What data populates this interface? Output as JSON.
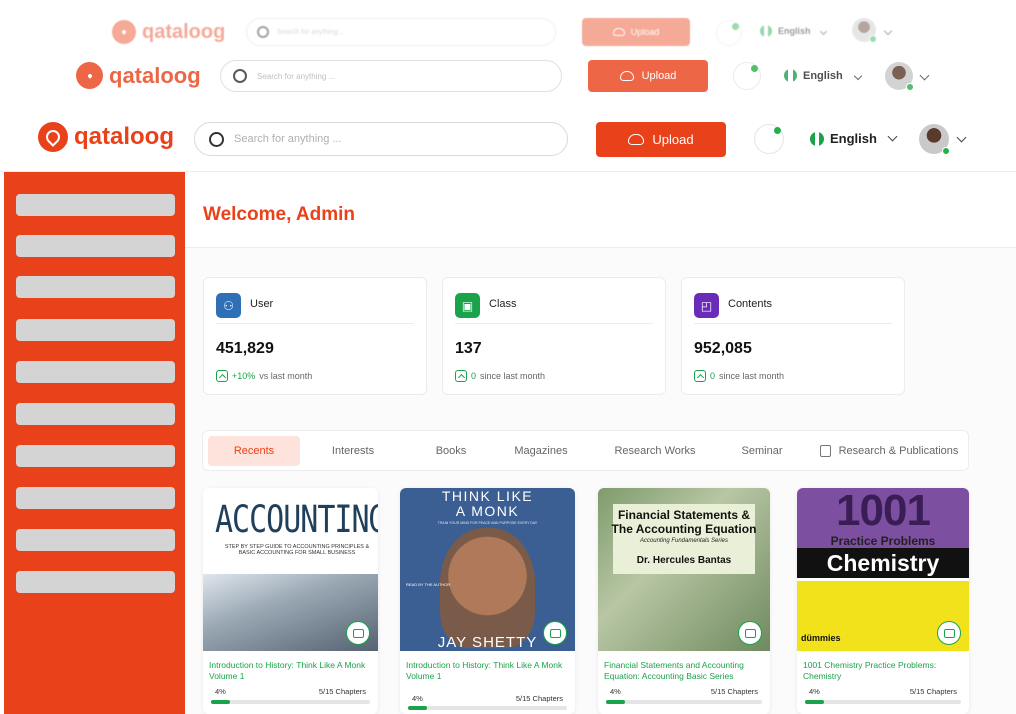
{
  "app": {
    "brand": "qataloog"
  },
  "header": {
    "search_placeholder": "Search for anything ...",
    "upload_label": "Upload",
    "language": "English"
  },
  "ghost_header": {
    "search_placeholder_small": "Search for anything...",
    "search_placeholder": "Search for anything ...",
    "upload_label": "Upload",
    "language": "English"
  },
  "page": {
    "welcome": "Welcome, Admin"
  },
  "stats": [
    {
      "label": "User",
      "value": "451,829",
      "delta": "+10%",
      "note": "vs last month",
      "color": "#2f6fb6"
    },
    {
      "label": "Class",
      "value": "137",
      "delta": "0",
      "note": "since last month",
      "color": "#1aa34a"
    },
    {
      "label": "Contents",
      "value": "952,085",
      "delta": "0",
      "note": "since last month",
      "color": "#6a2bb8"
    }
  ],
  "tabs": [
    "Recents",
    "Interests",
    "Books",
    "Magazines",
    "Research Works",
    "Seminar",
    "Research & Publications"
  ],
  "books": [
    {
      "title": "Introduction to History: Think Like A Monk Volume 1",
      "progress_pct": "4%",
      "progress": 0.04,
      "chapters": "5/15 Chapters",
      "cover": {
        "title": "ACCOUNTING",
        "subtitle": "STEP BY STEP GUIDE TO ACCOUNTING PRINCIPLES & BASIC ACCOUNTING FOR SMALL BUSINESS"
      }
    },
    {
      "title": "Introduction to History: Think Like A Monk Volume 1",
      "progress_pct": "4%",
      "progress": 0.04,
      "chapters": "5/15 Chapters",
      "cover": {
        "title_line1": "THINK LIKE",
        "title_line2": "A MONK",
        "subtitle": "TRAIN YOUR MIND FOR PEACE AND PURPOSE EVERY DAY",
        "read_by": "READ BY THE AUTHOR",
        "author": "JAY SHETTY"
      }
    },
    {
      "title": "Financial Statements and Accounting Equation: Accounting Basic Series",
      "progress_pct": "4%",
      "progress": 0.04,
      "chapters": "5/15 Chapters",
      "cover": {
        "title_line1": "Financial Statements &",
        "title_line2": "The Accounting Equation",
        "subtitle": "Accounting Fundamentals Series",
        "author": "Dr. Hercules Bantas"
      }
    },
    {
      "title": "1001 Chemistry Practice Problems: Chemistry",
      "progress_pct": "4%",
      "progress": 0.04,
      "chapters": "5/15 Chapters",
      "cover": {
        "title": "1001",
        "subtitle": "Practice Problems",
        "subject": "Chemistry",
        "brand": "dümmies"
      }
    }
  ]
}
